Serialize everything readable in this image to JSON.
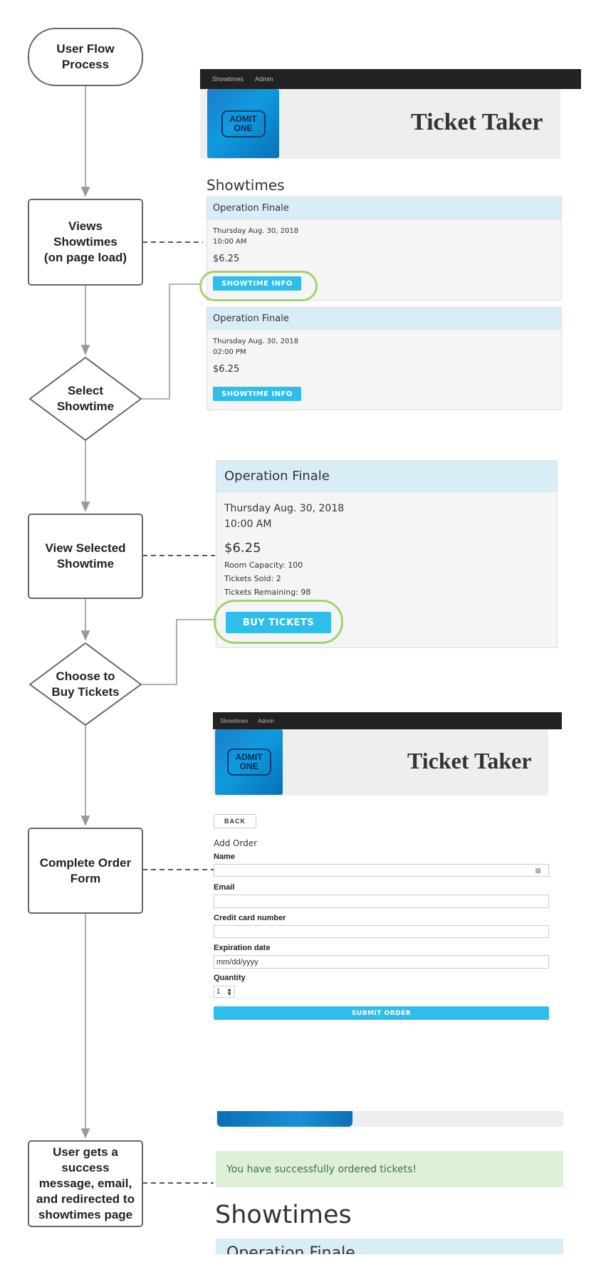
{
  "flow": {
    "start": "User Flow\nProcess",
    "views_showtimes": "Views\nShowtimes\n(on page load)",
    "select_showtime": "Select\nShowtime",
    "view_selected": "View Selected\nShowtime",
    "choose_buy": "Choose to\nBuy Tickets",
    "complete_order": "Complete Order\nForm",
    "success": "User gets a\nsuccess\nmessage, email,\nand redirected to\nshowtimes page"
  },
  "nav": {
    "showtimes": "Showtimes",
    "admin": "Admin"
  },
  "hero": {
    "title": "Ticket Taker",
    "ticket_text": "ADMIT\nONE"
  },
  "showtimes_page": {
    "heading": "Showtimes",
    "cards": [
      {
        "movie": "Operation Finale",
        "date": "Thursday Aug. 30, 2018",
        "time": "10:00 AM",
        "price": "$6.25",
        "button": "SHOWTIME INFO"
      },
      {
        "movie": "Operation Finale",
        "date": "Thursday Aug. 30, 2018",
        "time": "02:00 PM",
        "price": "$6.25",
        "button": "SHOWTIME INFO"
      }
    ]
  },
  "detail_page": {
    "movie": "Operation Finale",
    "date": "Thursday Aug. 30, 2018",
    "time": "10:00 AM",
    "price": "$6.25",
    "capacity": "Room Capacity: 100",
    "sold": "Tickets Sold: 2",
    "remaining": "Tickets Remaining: 98",
    "button": "BUY TICKETS"
  },
  "order_page": {
    "back": "BACK",
    "heading": "Add Order",
    "name_label": "Name",
    "email_label": "Email",
    "card_label": "Credit card number",
    "exp_label": "Expiration date",
    "exp_placeholder": "mm/dd/yyyy",
    "qty_label": "Quantity",
    "qty_value": "1",
    "submit": "SUBMIT ORDER"
  },
  "success_page": {
    "message": "You have successfully ordered tickets!",
    "heading": "Showtimes",
    "partial_card": "Operation Finale"
  },
  "colors": {
    "accent_button": "#2fbeec",
    "highlight_ring": "#a3d36c",
    "panel_heading": "#d9edf7",
    "success_bg": "#dff0d8"
  }
}
